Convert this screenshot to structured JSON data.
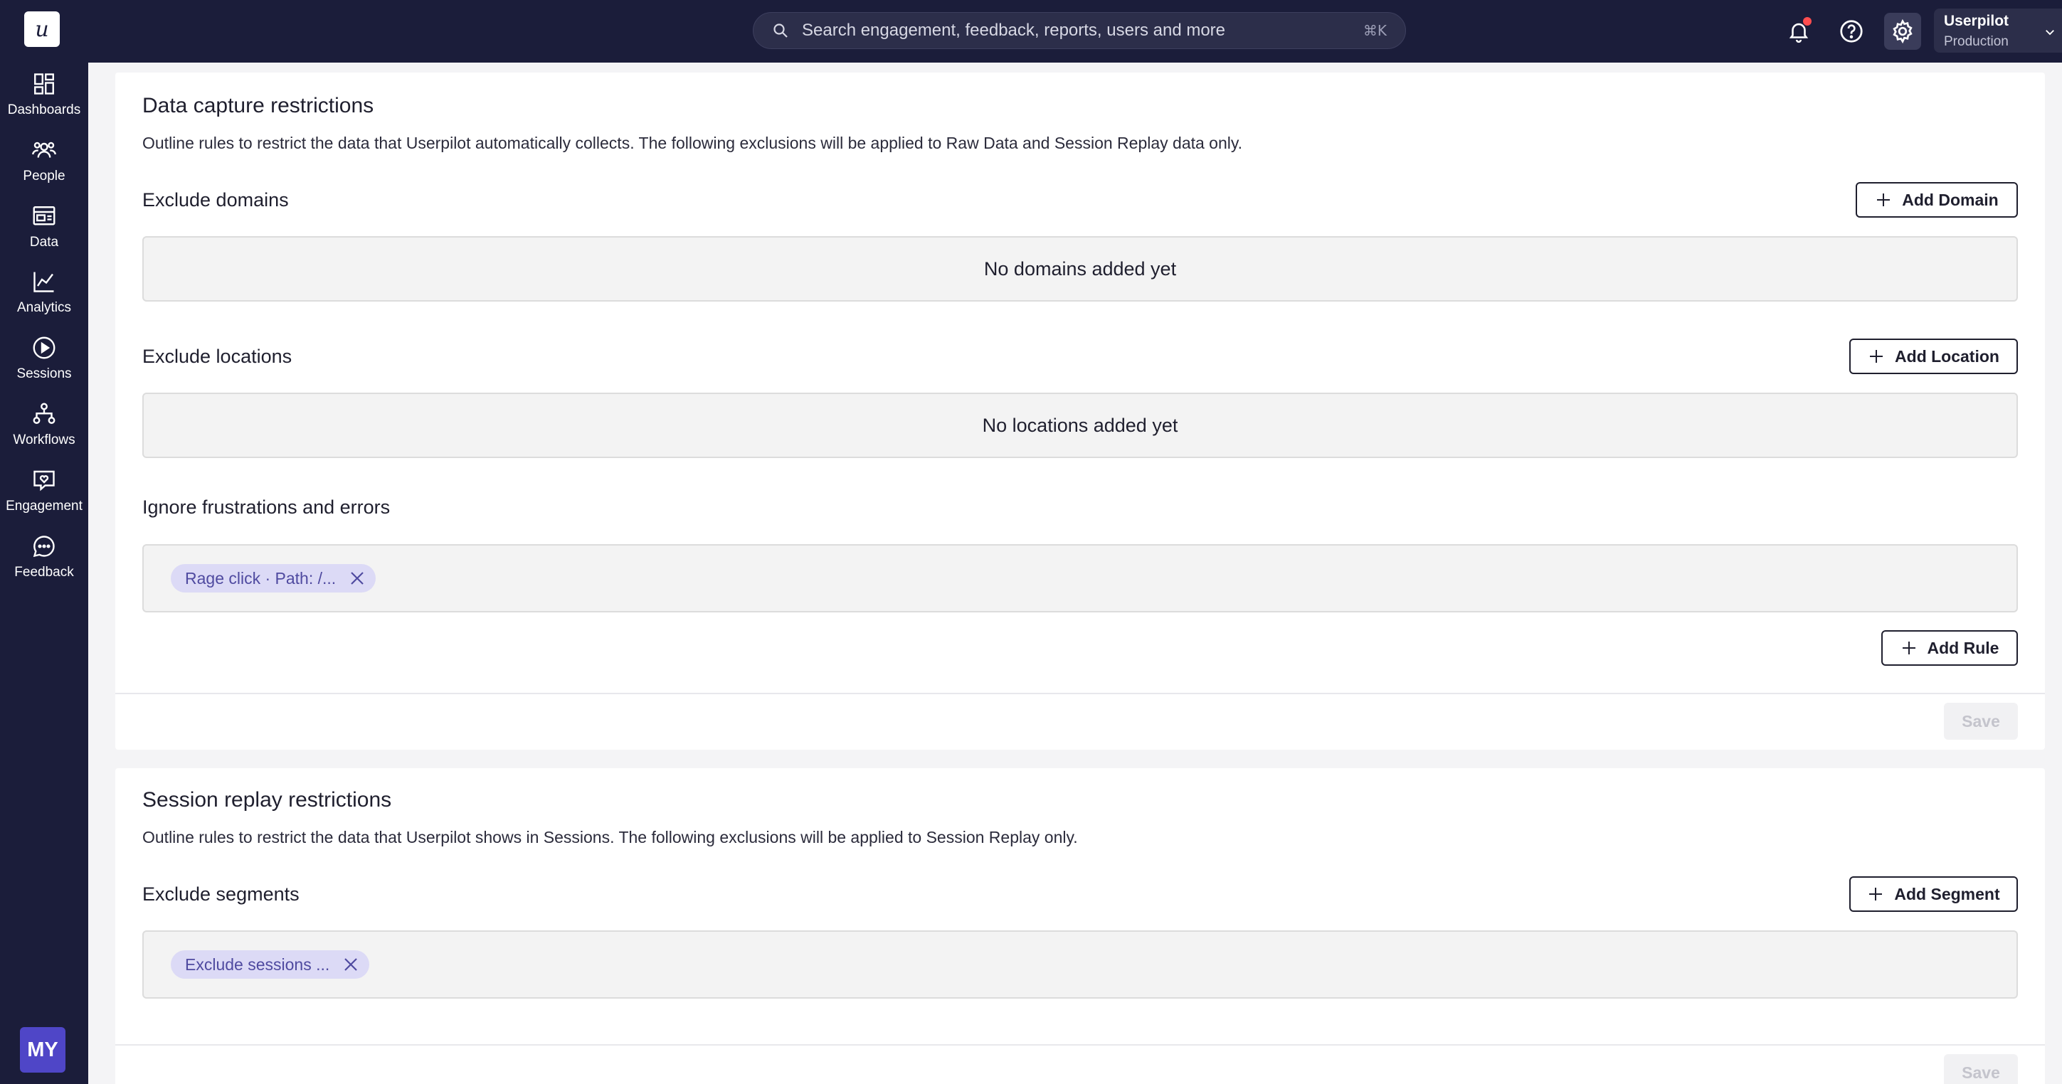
{
  "brand": {
    "logo_letter": "u"
  },
  "search": {
    "placeholder": "Search engagement, feedback, reports, users and more",
    "shortcut": "⌘K"
  },
  "account": {
    "name": "Userpilot",
    "environment": "Production"
  },
  "sidebar": {
    "items": [
      {
        "label": "Dashboards",
        "icon": "dashboard-icon"
      },
      {
        "label": "People",
        "icon": "people-icon"
      },
      {
        "label": "Data",
        "icon": "data-icon"
      },
      {
        "label": "Analytics",
        "icon": "analytics-icon"
      },
      {
        "label": "Sessions",
        "icon": "play-icon"
      },
      {
        "label": "Workflows",
        "icon": "workflow-icon"
      },
      {
        "label": "Engagement",
        "icon": "engagement-icon"
      },
      {
        "label": "Feedback",
        "icon": "chat-icon"
      }
    ],
    "avatar_initials": "MY"
  },
  "data_capture": {
    "title": "Data capture restrictions",
    "description": "Outline rules to restrict the data that Userpilot automatically collects. The following exclusions will be applied to Raw Data and Session Replay data only.",
    "exclude_domains": {
      "title": "Exclude domains",
      "button": "Add Domain",
      "empty": "No domains added yet"
    },
    "exclude_locations": {
      "title": "Exclude locations",
      "button": "Add Location",
      "empty": "No locations added yet"
    },
    "ignore_frustrations": {
      "title": "Ignore frustrations and errors",
      "chip": "Rage click · Path: /...",
      "button": "Add Rule"
    },
    "save": "Save"
  },
  "session_replay": {
    "title": "Session replay restrictions",
    "description": "Outline rules to restrict the data that Userpilot shows in Sessions. The following exclusions will be applied to Session Replay only.",
    "exclude_segments": {
      "title": "Exclude segments",
      "button": "Add Segment",
      "chip": "Exclude sessions ..."
    },
    "save": "Save"
  },
  "colors": {
    "nav_bg": "#1b1d3a",
    "chip_bg": "#dcdaf6",
    "chip_text": "#4f4aa0",
    "avatar": "#4f46c7",
    "notification": "#ff4d4f"
  }
}
